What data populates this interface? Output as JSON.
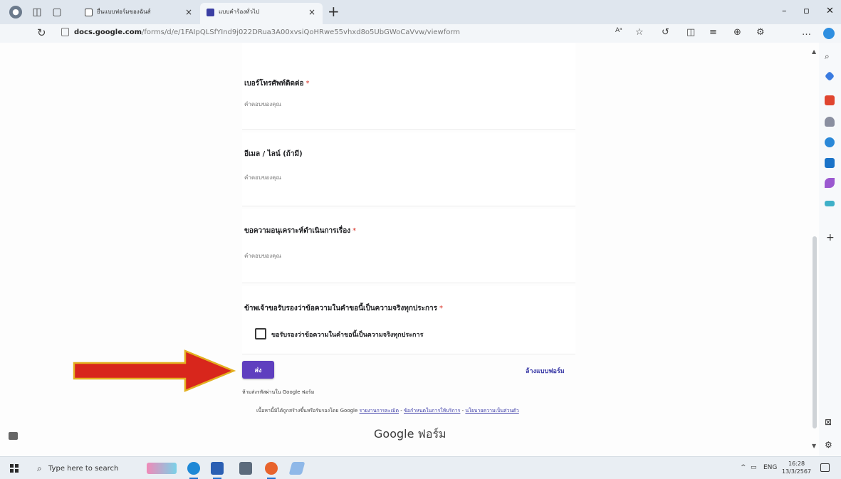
{
  "browser": {
    "tabs": [
      {
        "label": "ยื่นแบบฟอร์มของฉันส์",
        "close": "×"
      },
      {
        "label": "แบบคำร้องทั่วไป",
        "close": "×"
      }
    ],
    "new_tab": "+",
    "window_controls": {
      "minimize": "–",
      "maximize": "▫",
      "close": "✕"
    },
    "address": {
      "host": "docs.google.com",
      "path": "/forms/d/e/1FAIpQLSfYInd9j022DRua3A00xvsiQoHRwe55vhxd8o5UbGWoCaVvw/viewform"
    },
    "reader_label": "Aᵃ"
  },
  "form": {
    "questions": [
      {
        "title": "เบอร์โทรศัพท์ติดต่อ",
        "required": true,
        "placeholder": "คำตอบของคุณ"
      },
      {
        "title": "อีเมล / ไลน์ (ถ้ามี)",
        "required": false,
        "placeholder": "คำตอบของคุณ"
      },
      {
        "title": "ขอความอนุเคราะห์ดำเนินการเรื่อง",
        "required": true,
        "placeholder": "คำตอบของคุณ"
      },
      {
        "title": "ข้าพเจ้าขอรับรองว่าข้อความในคำขอนี้เป็นความจริงทุกประการ",
        "required": true,
        "checkbox_label": "ขอรับรองว่าข้อความในคำขอนี้เป็นความจริงทุกประการ"
      }
    ],
    "required_mark": "*",
    "submit_label": "ส่ง",
    "clear_label": "ล้างแบบฟอร์ม",
    "password_note": "ห้ามส่งรหัสผ่านใน Google ฟอร์ม",
    "footer": {
      "prefix": "เนื้อหานี้มิได้ถูกสร้างขึ้นหรือรับรองโดย Google",
      "report_link": "รายงานการละเมิด",
      "sep1": " - ",
      "terms_link": "ข้อกำหนดในการให้บริการ",
      "sep2": " - ",
      "privacy_link": "นโยบายความเป็นส่วนตัว"
    },
    "brand": "Google ฟอร์ม"
  },
  "taskbar": {
    "search_placeholder": "Type here to search",
    "tray_lang": "ENG",
    "time": "16:28",
    "date": "13/3/2567",
    "tray_chevron": "^"
  },
  "colors": {
    "submit_button": "#5f3fbf",
    "arrow_fill": "#d8261c",
    "arrow_outline": "#e3b020",
    "required": "#d93025",
    "link": "#3d3da8"
  },
  "icons": [
    "search-icon",
    "reload-icon",
    "lock-icon",
    "star-icon",
    "checkbox-icon",
    "arrow-annotation",
    "windows-start-icon",
    "edge-icon",
    "word-icon",
    "calculator-icon",
    "firefox-icon"
  ]
}
